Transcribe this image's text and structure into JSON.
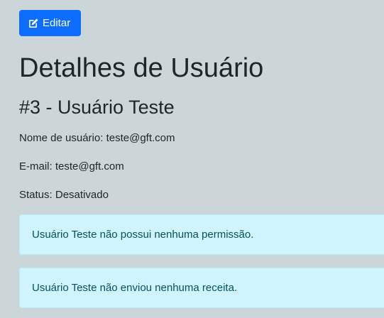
{
  "toolbar": {
    "edit_label": "Editar",
    "edit_icon": "edit-square-pen-icon",
    "edit_color": "#0d6efd"
  },
  "page": {
    "title": "Detalhes de Usuário",
    "user_heading": "#3 - Usuário Teste"
  },
  "details": {
    "username_label": "Nome de usuário:",
    "username_value": "teste@gft.com",
    "email_label": "E-mail:",
    "email_value": "teste@gft.com",
    "status_label": "Status:",
    "status_value": "Desativado"
  },
  "alerts": [
    {
      "text": "Usuário Teste não possui nenhuma permissão."
    },
    {
      "text": "Usuário Teste não enviou nenhuma receita."
    }
  ],
  "colors": {
    "background": "#ccd6d8",
    "alert_background": "#cff4fc",
    "alert_text": "#055160"
  }
}
